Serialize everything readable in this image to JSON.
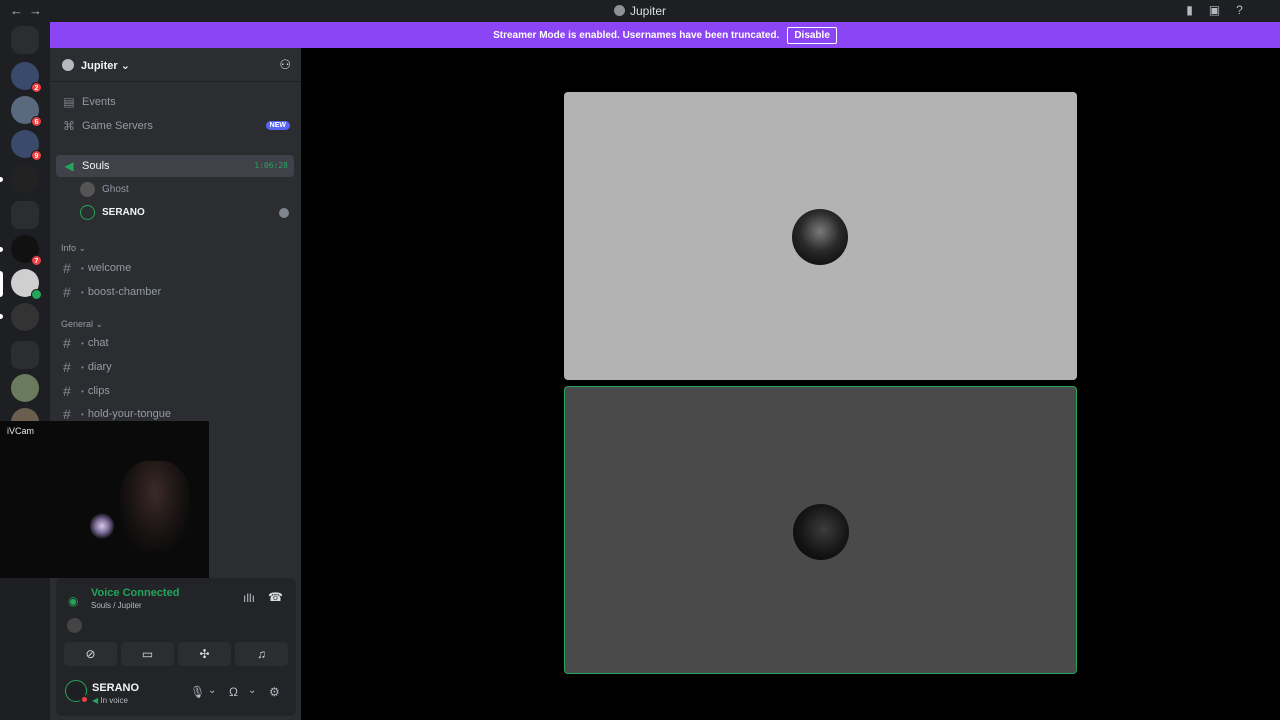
{
  "window": {
    "title": "Jupiter",
    "nav_back": "←",
    "nav_forward": "→"
  },
  "titlebar_icons": [
    "bookmark-icon",
    "inbox-icon",
    "help-icon"
  ],
  "streamer_banner": {
    "text": "Streamer Mode is enabled. Usernames have been truncated.",
    "button": "Disable",
    "color": "#8b45f5"
  },
  "guild_badges": [
    "2",
    "6",
    "9",
    "7"
  ],
  "server": {
    "name": "Jupiter",
    "chevron": "⌄"
  },
  "nav_items": [
    {
      "label": "Events"
    },
    {
      "label": "Game Servers",
      "badge": "NEW"
    }
  ],
  "voice_channel": {
    "name": "Souls",
    "timer": "1:06:28",
    "members": [
      {
        "name": "Ghost",
        "speaking": false
      },
      {
        "name": "SERANO",
        "speaking": true
      }
    ]
  },
  "categories": [
    {
      "name": "Info",
      "channels": [
        "welcome",
        "boost-chamber"
      ]
    },
    {
      "name": "General",
      "channels": [
        "chat",
        "diary",
        "clips",
        "hold-your-tongue"
      ]
    }
  ],
  "webcam": {
    "label": "iVCam"
  },
  "voice_panel": {
    "title": "Voice Connected",
    "subtitle": "Souls / Jupiter"
  },
  "user": {
    "name": "SERANO",
    "status": "In voice"
  },
  "colors": {
    "accent_green": "#23a55a",
    "sidebar": "#2b2d31",
    "rail": "#1e1f22"
  }
}
